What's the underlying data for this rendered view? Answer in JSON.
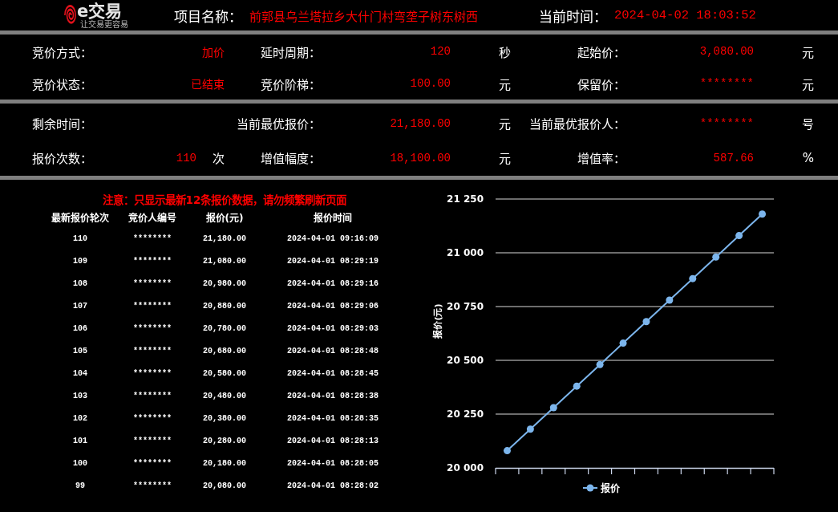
{
  "header": {
    "logo": {
      "name": "e交易",
      "slogan": "让交易更容易"
    },
    "project_label": "项目名称：",
    "project_name": "前郭县乌兰塔拉乡大什门村弯垄子树东树西",
    "time_label": "当前时间：",
    "current_time": "2024-04-02 18:03:52"
  },
  "info_sections": [
    {
      "rows": [
        [
          {
            "label": "竞价方式：",
            "value": "加价"
          },
          {
            "label": "延时周期：",
            "value": "120",
            "unit": "秒"
          },
          {
            "label": "起始价：",
            "value": "3,080.00",
            "unit": "元"
          }
        ],
        [
          {
            "label": "竞价状态：",
            "value": "已结束"
          },
          {
            "label": "竞价阶梯：",
            "value": "100.00",
            "unit": "元"
          },
          {
            "label": "保留价：",
            "value": "********",
            "unit": "元"
          }
        ]
      ]
    },
    {
      "rows": [
        [
          {
            "label": "剩余时间："
          },
          {
            "label": "当前最优报价：",
            "value": "21,180.00",
            "unit": "元"
          },
          {
            "label": "当前最优报价人：",
            "value": "********",
            "unit": "号"
          }
        ],
        [
          {
            "label": "报价次数：",
            "value": "110",
            "unit": "次"
          },
          {
            "label": "增值幅度：",
            "value": "18,100.00",
            "unit": "元"
          },
          {
            "label": "增值率：",
            "value": "587.66",
            "unit": "%"
          }
        ]
      ]
    }
  ],
  "bids": {
    "notice": "注意：只显示最新12条报价数据，请勿频繁刷新页面",
    "columns": [
      "最新报价轮次",
      "竞价人编号",
      "报价(元)",
      "报价时间"
    ],
    "rows": [
      [
        "110",
        "********",
        "21,180.00",
        "2024-04-01 09:16:09"
      ],
      [
        "109",
        "********",
        "21,080.00",
        "2024-04-01 08:29:19"
      ],
      [
        "108",
        "********",
        "20,980.00",
        "2024-04-01 08:29:16"
      ],
      [
        "107",
        "********",
        "20,880.00",
        "2024-04-01 08:29:06"
      ],
      [
        "106",
        "********",
        "20,780.00",
        "2024-04-01 08:29:03"
      ],
      [
        "105",
        "********",
        "20,680.00",
        "2024-04-01 08:28:48"
      ],
      [
        "104",
        "********",
        "20,580.00",
        "2024-04-01 08:28:45"
      ],
      [
        "103",
        "********",
        "20,480.00",
        "2024-04-01 08:28:38"
      ],
      [
        "102",
        "********",
        "20,380.00",
        "2024-04-01 08:28:35"
      ],
      [
        "101",
        "********",
        "20,280.00",
        "2024-04-01 08:28:13"
      ],
      [
        "100",
        "********",
        "20,180.00",
        "2024-04-01 08:28:05"
      ],
      [
        "99",
        "********",
        "20,080.00",
        "2024-04-01 08:28:02"
      ]
    ]
  },
  "chart": {
    "chart_data": {
      "type": "line",
      "ylabel": "报价(元)",
      "grid": true,
      "series": [
        {
          "name": "报价",
          "color": "#7cb5ec",
          "marker": true,
          "values": [
            20080,
            20180,
            20280,
            20380,
            20480,
            20580,
            20680,
            20780,
            20880,
            20980,
            21080,
            21180
          ]
        }
      ],
      "ylim": [
        20000,
        21250
      ],
      "yticks": [
        {
          "value": 20000,
          "label": "20 000"
        },
        {
          "value": 20250,
          "label": "20 250"
        },
        {
          "value": 20500,
          "label": "20 500"
        },
        {
          "value": 20750,
          "label": "20 750"
        },
        {
          "value": 21000,
          "label": "21 000"
        },
        {
          "value": 21250,
          "label": "21 250"
        }
      ]
    }
  }
}
